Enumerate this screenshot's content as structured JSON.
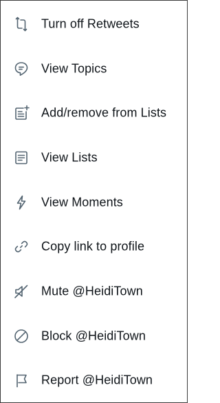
{
  "menu": {
    "items": [
      {
        "label": "Turn off Retweets",
        "icon": "retweet-icon"
      },
      {
        "label": "View Topics",
        "icon": "topics-icon"
      },
      {
        "label": "Add/remove from Lists",
        "icon": "list-add-icon"
      },
      {
        "label": "View Lists",
        "icon": "lists-icon"
      },
      {
        "label": "View Moments",
        "icon": "moments-icon"
      },
      {
        "label": "Copy link to profile",
        "icon": "link-icon"
      },
      {
        "label": "Mute @HeidiTown",
        "icon": "mute-icon"
      },
      {
        "label": "Block @HeidiTown",
        "icon": "block-icon"
      },
      {
        "label": "Report @HeidiTown",
        "icon": "flag-icon"
      }
    ]
  },
  "colors": {
    "icon": "#536471",
    "text": "#0f1419",
    "border": "#3a3a3a",
    "background": "#ffffff"
  }
}
